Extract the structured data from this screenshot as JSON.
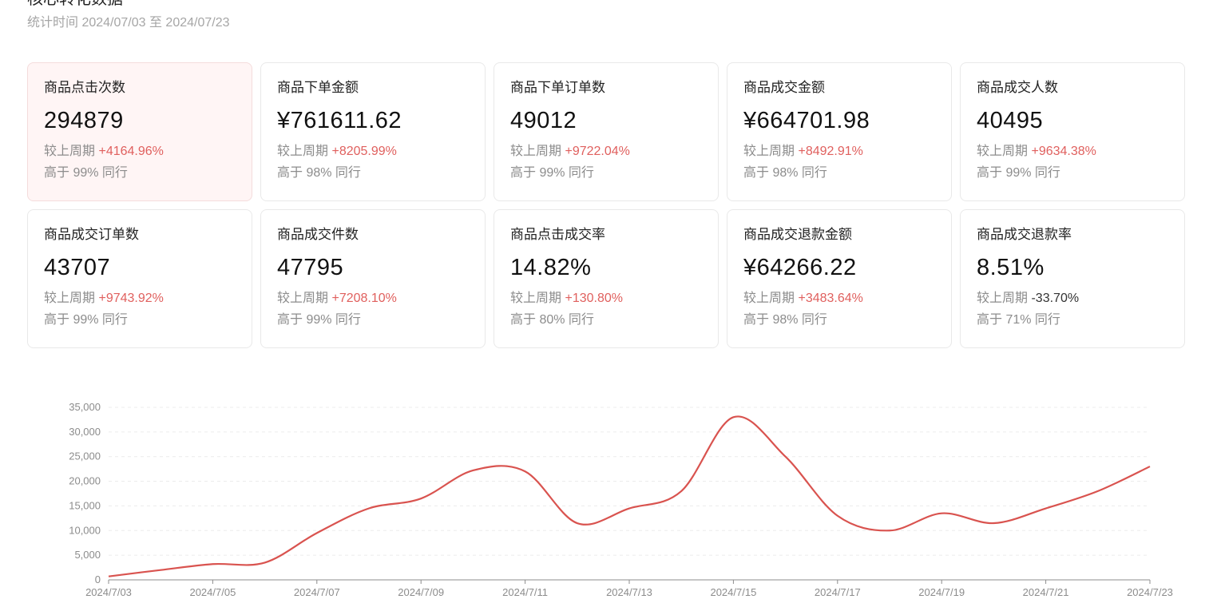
{
  "header": {
    "title": "核心转化数据",
    "subtitle": "统计时间 2024/07/03 至 2024/07/23"
  },
  "cards": [
    {
      "label": "商品点击次数",
      "value": "294879",
      "cmp_label": "较上周期",
      "change": "+4164.96%",
      "direction": "up",
      "peer": "高于 99% 同行",
      "active": true
    },
    {
      "label": "商品下单金额",
      "value": "¥761611.62",
      "cmp_label": "较上周期",
      "change": "+8205.99%",
      "direction": "up",
      "peer": "高于 98% 同行",
      "active": false
    },
    {
      "label": "商品下单订单数",
      "value": "49012",
      "cmp_label": "较上周期",
      "change": "+9722.04%",
      "direction": "up",
      "peer": "高于 99% 同行",
      "active": false
    },
    {
      "label": "商品成交金额",
      "value": "¥664701.98",
      "cmp_label": "较上周期",
      "change": "+8492.91%",
      "direction": "up",
      "peer": "高于 98% 同行",
      "active": false
    },
    {
      "label": "商品成交人数",
      "value": "40495",
      "cmp_label": "较上周期",
      "change": "+9634.38%",
      "direction": "up",
      "peer": "高于 99% 同行",
      "active": false
    },
    {
      "label": "商品成交订单数",
      "value": "43707",
      "cmp_label": "较上周期",
      "change": "+9743.92%",
      "direction": "up",
      "peer": "高于 99% 同行",
      "active": false
    },
    {
      "label": "商品成交件数",
      "value": "47795",
      "cmp_label": "较上周期",
      "change": "+7208.10%",
      "direction": "up",
      "peer": "高于 99% 同行",
      "active": false
    },
    {
      "label": "商品点击成交率",
      "value": "14.82%",
      "cmp_label": "较上周期",
      "change": "+130.80%",
      "direction": "up",
      "peer": "高于 80% 同行",
      "active": false
    },
    {
      "label": "商品成交退款金额",
      "value": "¥64266.22",
      "cmp_label": "较上周期",
      "change": "+3483.64%",
      "direction": "up",
      "peer": "高于 98% 同行",
      "active": false
    },
    {
      "label": "商品成交退款率",
      "value": "8.51%",
      "cmp_label": "较上周期",
      "change": "-33.70%",
      "direction": "down",
      "peer": "高于 71% 同行",
      "active": false
    }
  ],
  "colors": {
    "accent_red": "#e0605e",
    "line": "#d9534f",
    "active_card_bg": "#fff5f5"
  },
  "chart_data": {
    "type": "line",
    "x": [
      "2024/7/03",
      "2024/7/04",
      "2024/7/05",
      "2024/7/06",
      "2024/7/07",
      "2024/7/08",
      "2024/7/09",
      "2024/7/10",
      "2024/7/11",
      "2024/7/12",
      "2024/7/13",
      "2024/7/14",
      "2024/7/15",
      "2024/7/16",
      "2024/7/17",
      "2024/7/18",
      "2024/7/19",
      "2024/7/20",
      "2024/7/21",
      "2024/7/22",
      "2024/7/23"
    ],
    "x_tick_labels": [
      "2024/7/03",
      "2024/7/05",
      "2024/7/07",
      "2024/7/09",
      "2024/7/11",
      "2024/7/13",
      "2024/7/15",
      "2024/7/17",
      "2024/7/19",
      "2024/7/21",
      "2024/7/23"
    ],
    "series": [
      {
        "values": [
          700,
          2000,
          3200,
          3500,
          9500,
          14500,
          16500,
          22200,
          22000,
          11500,
          14500,
          18000,
          33000,
          25000,
          13000,
          10000,
          13500,
          11500,
          14500,
          18000,
          23000
        ]
      }
    ],
    "y_ticks": [
      0,
      5000,
      10000,
      15000,
      20000,
      25000,
      30000,
      35000
    ],
    "y_tick_labels": [
      "0",
      "5,000",
      "10,000",
      "15,000",
      "20,000",
      "25,000",
      "30,000",
      "35,000"
    ],
    "ylim": [
      0,
      35000
    ],
    "grid": true,
    "legend": false
  }
}
